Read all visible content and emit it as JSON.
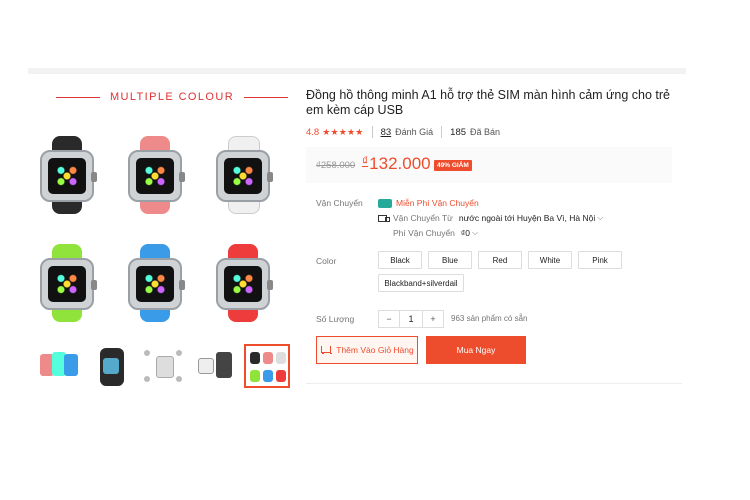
{
  "gallery": {
    "banner_text": "MULTIPLE COLOUR",
    "watch_colors": [
      {
        "name": "black",
        "strap": "#2a2a2a"
      },
      {
        "name": "pink",
        "strap": "#ef8a8a"
      },
      {
        "name": "white",
        "strap": "#f0f0f0"
      },
      {
        "name": "green",
        "strap": "#8fe33a"
      },
      {
        "name": "blue",
        "strap": "#3a9be8"
      },
      {
        "name": "red",
        "strap": "#ee3b3b"
      }
    ]
  },
  "product": {
    "title": "Đồng hồ thông minh A1 hỗ trợ thẻ SIM màn hình cảm ứng cho trẻ em kèm cáp USB",
    "rating": "4.8",
    "stars": "★★★★★",
    "reviews_count": "83",
    "reviews_label": "Đánh Giá",
    "sold_count": "185",
    "sold_label": "Đã Bán",
    "old_price": "₫258.000",
    "currency": "₫",
    "price": "132.000",
    "discount_badge": "49% GIẢM"
  },
  "shipping": {
    "label": "Vận Chuyển",
    "free_text": "Miễn Phí Vận Chuyển",
    "from_label": "Vận Chuyển Từ",
    "from_value": "nước ngoài tới Huyện Ba Vì, Hà Nội",
    "fee_label": "Phí Vận Chuyển",
    "fee_value": "₫0"
  },
  "color": {
    "label": "Color",
    "options": [
      "Black",
      "Blue",
      "Red",
      "White",
      "Pink",
      "Blackband+silverdail"
    ]
  },
  "quantity": {
    "label": "Số Lượng",
    "minus": "−",
    "value": "1",
    "plus": "+",
    "stock_text": "963 sản phẩm có sẵn"
  },
  "actions": {
    "add_to_cart": "Thêm Vào Giỏ Hàng",
    "buy_now": "Mua Ngay"
  }
}
